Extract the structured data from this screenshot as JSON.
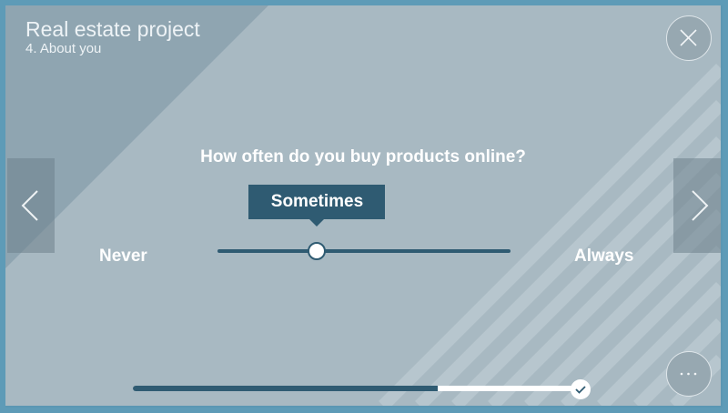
{
  "header": {
    "title": "Real estate project",
    "subtitle": "4. About you"
  },
  "question": {
    "text": "How often do you buy products online?"
  },
  "slider": {
    "selected_label": "Sometimes",
    "min_label": "Never",
    "max_label": "Always",
    "value_fraction": 0.34
  },
  "progress": {
    "fraction": 0.68
  },
  "icons": {
    "close": "close-icon",
    "more": "more-icon",
    "prev": "chevron-left-icon",
    "next": "chevron-right-icon",
    "check": "check-icon"
  },
  "colors": {
    "accent": "#2f5b72",
    "background": "#a8b9c2",
    "frame": "#5e9bb7"
  }
}
